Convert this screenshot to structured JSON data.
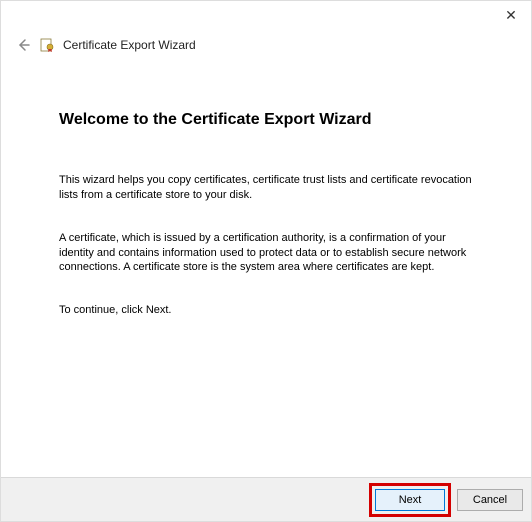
{
  "window": {
    "title": "Certificate Export Wizard"
  },
  "page": {
    "heading": "Welcome to the Certificate Export Wizard",
    "intro": "This wizard helps you copy certificates, certificate trust lists and certificate revocation lists from a certificate store to your disk.",
    "explain": "A certificate, which is issued by a certification authority, is a confirmation of your identity and contains information used to protect data or to establish secure network connections. A certificate store is the system area where certificates are kept.",
    "continue": "To continue, click Next."
  },
  "buttons": {
    "next": "Next",
    "cancel": "Cancel"
  }
}
